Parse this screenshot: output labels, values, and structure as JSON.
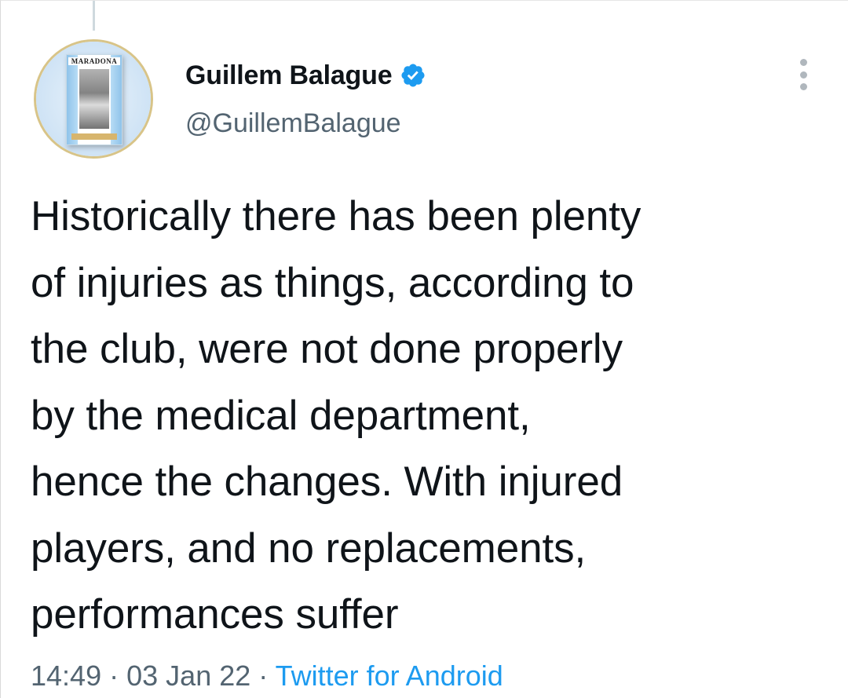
{
  "avatar": {
    "book_title": "MARADONA"
  },
  "author": {
    "display_name": "Guillem Balague",
    "handle": "@GuillemBalague",
    "verified": true
  },
  "tweet": {
    "lines": [
      "Historically there has been plenty",
      "of injuries as things, according to",
      "the club, were not done properly",
      "by the medical department,",
      "hence the changes. With injured",
      "players, and no replacements,",
      "performances suffer"
    ]
  },
  "meta": {
    "time": "14:49",
    "separator": "·",
    "date": "03 Jan 22",
    "source": "Twitter for Android"
  },
  "icons": {
    "verified": "verified-badge-icon",
    "more": "more-options-icon"
  },
  "colors": {
    "text": "#0f1419",
    "secondary": "#536471",
    "accent": "#1d9bf0"
  }
}
